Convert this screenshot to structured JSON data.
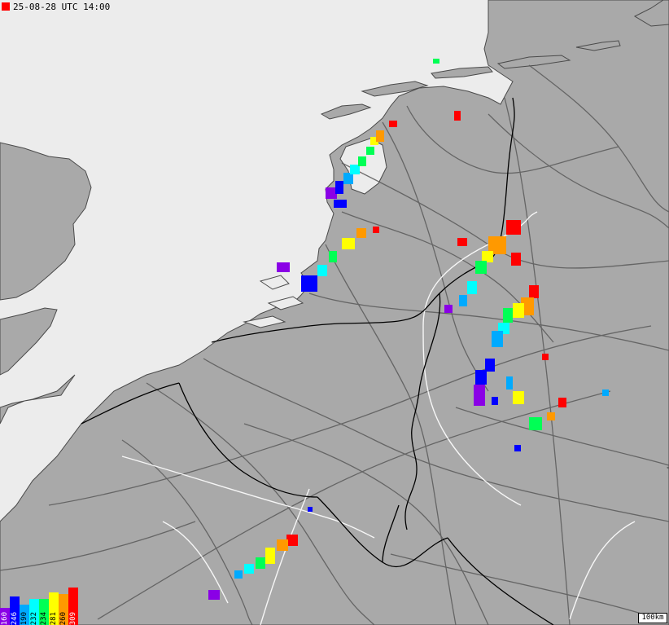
{
  "header": {
    "timestamp": "25-08-28 UTC 14:00",
    "marker_color": "#ff0000"
  },
  "scale": {
    "label": "100km"
  },
  "legend": [
    {
      "label": "160",
      "color": "#8a00e6",
      "level": 0.45
    },
    {
      "label": "246",
      "color": "#0000ff",
      "level": 0.75
    },
    {
      "label": "190",
      "color": "#00aaff",
      "level": 0.55
    },
    {
      "label": "232",
      "color": "#00ffff",
      "level": 0.7
    },
    {
      "label": "234",
      "color": "#00ff55",
      "level": 0.7
    },
    {
      "label": "281",
      "color": "#ffff00",
      "level": 0.88
    },
    {
      "label": "260",
      "color": "#ff9900",
      "level": 0.82
    },
    {
      "label": "309",
      "color": "#ff0000",
      "level": 1.0
    }
  ],
  "colors": {
    "sea": "#ececec",
    "land": "#a9a9a9",
    "coast": "#4a4a4a",
    "roads": "#5a5a5a",
    "borders": "#000000",
    "rivers": "#ffffff",
    "clusters": [
      "#8a00e6",
      "#0000ff",
      "#00aaff",
      "#00ffff",
      "#00ff55",
      "#ffff00",
      "#ff9900",
      "#ff0000"
    ]
  }
}
